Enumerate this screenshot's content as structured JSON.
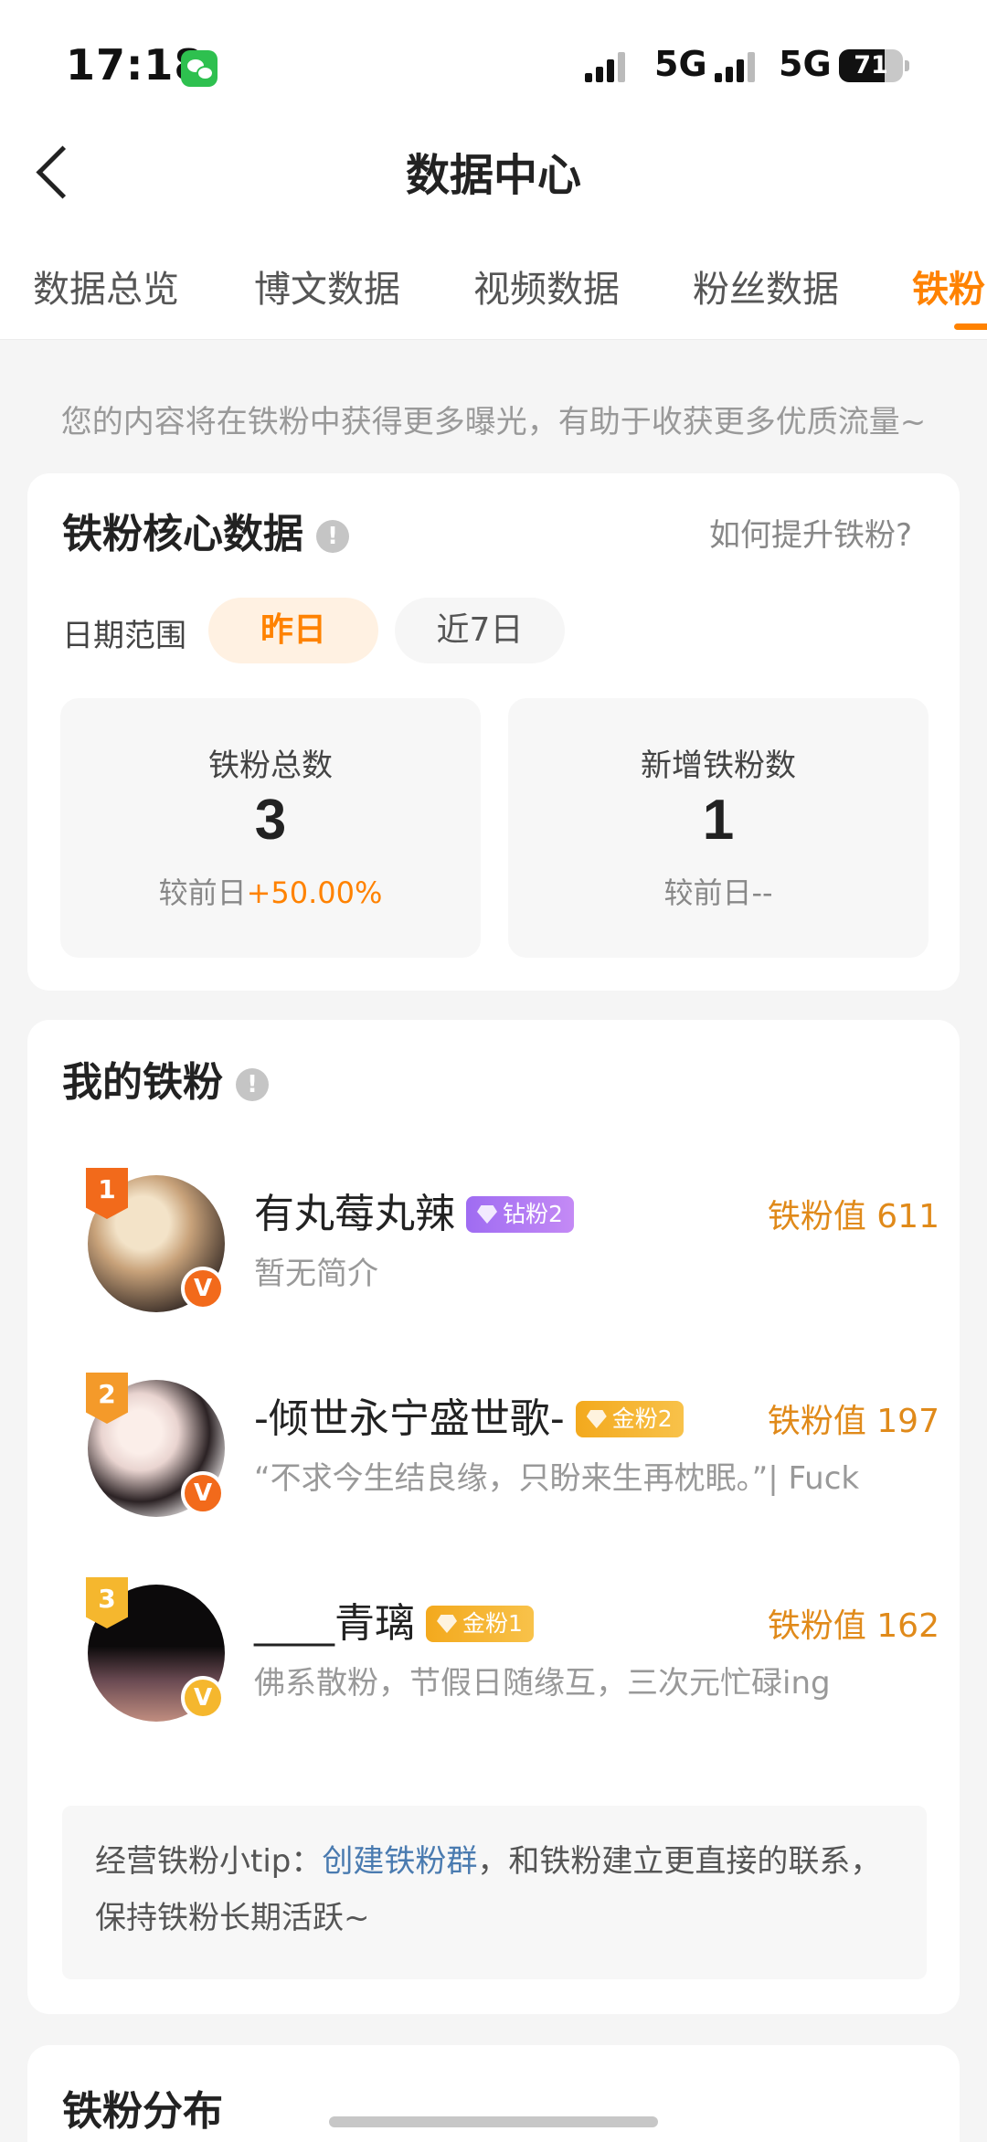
{
  "status_bar": {
    "time": "17:18",
    "network_1": "5G",
    "network_2": "5G",
    "battery": "71"
  },
  "nav": {
    "title": "数据中心"
  },
  "tabs": [
    {
      "label": "数据总览",
      "active": false
    },
    {
      "label": "博文数据",
      "active": false
    },
    {
      "label": "视频数据",
      "active": false
    },
    {
      "label": "粉丝数据",
      "active": false
    },
    {
      "label": "铁粉",
      "active": true
    }
  ],
  "hint": "您的内容将在铁粉中获得更多曝光，有助于收获更多优质流量~",
  "core": {
    "title": "铁粉核心数据",
    "how_link": "如何提升铁粉?",
    "range_label": "日期范围",
    "range_options": [
      "昨日",
      "近7日"
    ],
    "selected_range": "昨日",
    "stats": [
      {
        "label": "铁粉总数",
        "value": "3",
        "compare_prefix": "较前日",
        "compare_value": "+50.00%"
      },
      {
        "label": "新增铁粉数",
        "value": "1",
        "compare_prefix": "较前日",
        "compare_value": "--"
      }
    ]
  },
  "my_fans": {
    "title": "我的铁粉",
    "list": [
      {
        "rank": "1",
        "name": "有丸莓丸辣",
        "level": "钻粉2",
        "value_label": "铁粉值 611",
        "desc": "暂无简介"
      },
      {
        "rank": "2",
        "name": "-倾世永宁盛世歌-",
        "level": "金粉2",
        "value_label": "铁粉值 197",
        "desc": "“不求今生结良缘，只盼来生再枕眠。”| Fuck"
      },
      {
        "rank": "3",
        "name": "____青璃",
        "level": "金粉1",
        "value_label": "铁粉值 162",
        "desc": "佛系散粉，节假日随缘互，三次元忙碌ing"
      }
    ],
    "tip_prefix": "经营铁粉小tip：",
    "tip_link": "创建铁粉群",
    "tip_suffix": "，和铁粉建立更直接的联系，保持铁粉长期活跃~"
  },
  "distribution": {
    "title": "铁粉分布"
  },
  "colors": {
    "accent": "#ff8200",
    "diamond": "#a56ef0",
    "gold": "#f5b72e",
    "rank1": "#f26a1b",
    "rank2": "#f49a2a",
    "rank3": "#f5b72e"
  }
}
